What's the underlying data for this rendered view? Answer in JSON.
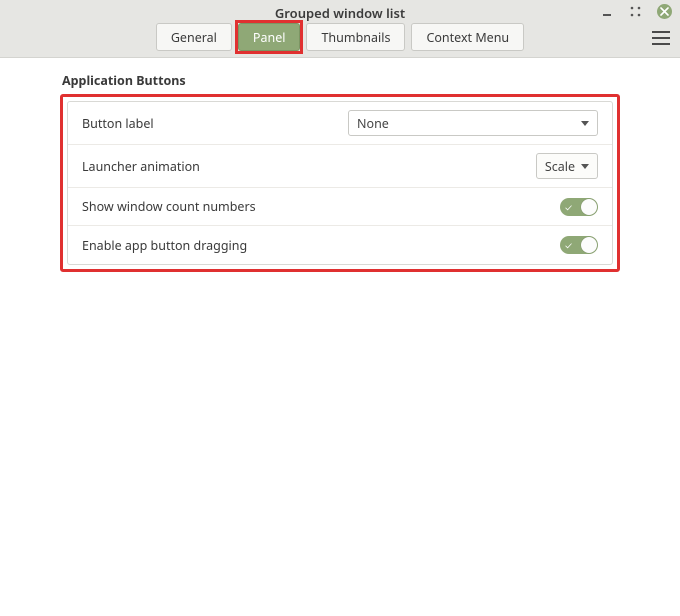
{
  "window": {
    "title": "Grouped window list"
  },
  "tabs": {
    "general": "General",
    "panel": "Panel",
    "thumbnails": "Thumbnails",
    "context_menu": "Context Menu"
  },
  "section": {
    "title": "Application Buttons"
  },
  "rows": {
    "button_label": {
      "label": "Button label",
      "value": "None"
    },
    "launcher_animation": {
      "label": "Launcher animation",
      "value": "Scale"
    },
    "show_count": {
      "label": "Show window count numbers",
      "value": true
    },
    "enable_drag": {
      "label": "Enable app button dragging",
      "value": true
    }
  }
}
